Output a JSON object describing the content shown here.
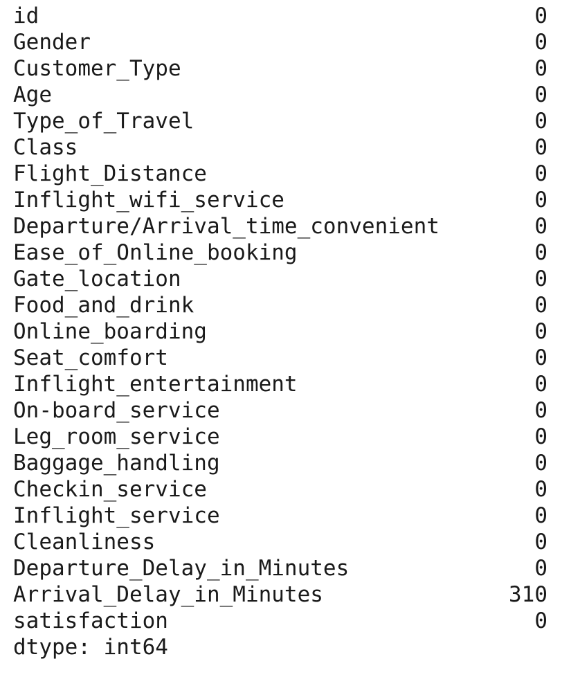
{
  "output": {
    "rows": [
      {
        "name": "id",
        "value": "0"
      },
      {
        "name": "Gender",
        "value": "0"
      },
      {
        "name": "Customer_Type",
        "value": "0"
      },
      {
        "name": "Age",
        "value": "0"
      },
      {
        "name": "Type_of_Travel",
        "value": "0"
      },
      {
        "name": "Class",
        "value": "0"
      },
      {
        "name": "Flight_Distance",
        "value": "0"
      },
      {
        "name": "Inflight_wifi_service",
        "value": "0"
      },
      {
        "name": "Departure/Arrival_time_convenient",
        "value": "0"
      },
      {
        "name": "Ease_of_Online_booking",
        "value": "0"
      },
      {
        "name": "Gate_location",
        "value": "0"
      },
      {
        "name": "Food_and_drink",
        "value": "0"
      },
      {
        "name": "Online_boarding",
        "value": "0"
      },
      {
        "name": "Seat_comfort",
        "value": "0"
      },
      {
        "name": "Inflight_entertainment",
        "value": "0"
      },
      {
        "name": "On-board_service",
        "value": "0"
      },
      {
        "name": "Leg_room_service",
        "value": "0"
      },
      {
        "name": "Baggage_handling",
        "value": "0"
      },
      {
        "name": "Checkin_service",
        "value": "0"
      },
      {
        "name": "Inflight_service",
        "value": "0"
      },
      {
        "name": "Cleanliness",
        "value": "0"
      },
      {
        "name": "Departure_Delay_in_Minutes",
        "value": "0"
      },
      {
        "name": "Arrival_Delay_in_Minutes",
        "value": "310"
      },
      {
        "name": "satisfaction",
        "value": "0"
      }
    ],
    "dtype": "dtype: int64"
  }
}
